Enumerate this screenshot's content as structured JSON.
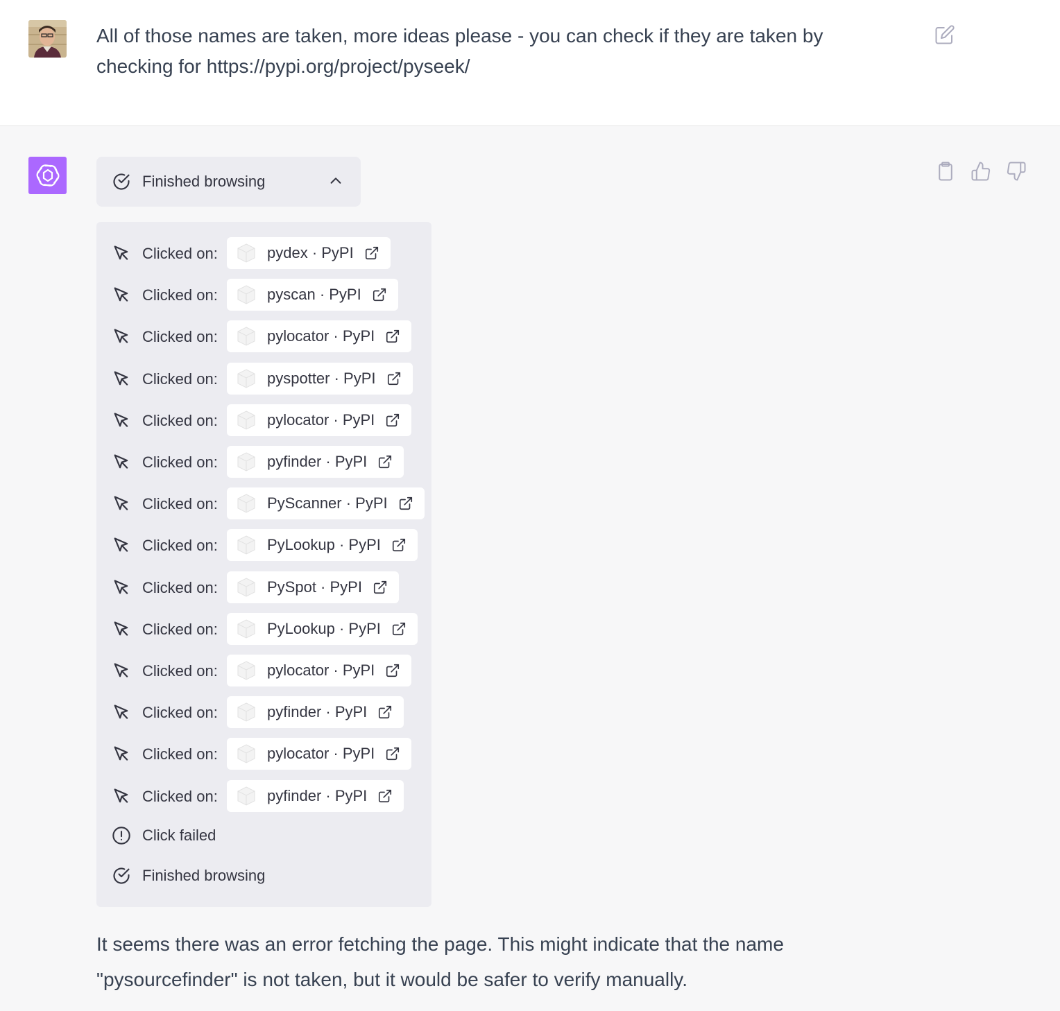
{
  "user_message": {
    "text": "All of those names are taken, more ideas please - you can check if they are taken by checking for https://pypi.org/project/pyseek/"
  },
  "assistant": {
    "browse_toggle_label": "Finished browsing",
    "log": [
      {
        "action": "Clicked on:",
        "link": "pydex · PyPI"
      },
      {
        "action": "Clicked on:",
        "link": "pyscan · PyPI"
      },
      {
        "action": "Clicked on:",
        "link": "pylocator · PyPI"
      },
      {
        "action": "Clicked on:",
        "link": "pyspotter · PyPI"
      },
      {
        "action": "Clicked on:",
        "link": "pylocator · PyPI"
      },
      {
        "action": "Clicked on:",
        "link": "pyfinder · PyPI"
      },
      {
        "action": "Clicked on:",
        "link": "PyScanner · PyPI"
      },
      {
        "action": "Clicked on:",
        "link": "PyLookup · PyPI"
      },
      {
        "action": "Clicked on:",
        "link": "PySpot · PyPI"
      },
      {
        "action": "Clicked on:",
        "link": "PyLookup · PyPI"
      },
      {
        "action": "Clicked on:",
        "link": "pylocator · PyPI"
      },
      {
        "action": "Clicked on:",
        "link": "pyfinder · PyPI"
      },
      {
        "action": "Clicked on:",
        "link": "pylocator · PyPI"
      },
      {
        "action": "Clicked on:",
        "link": "pyfinder · PyPI"
      }
    ],
    "click_failed_label": "Click failed",
    "finished_label": "Finished browsing",
    "reply_text": "It seems there was an error fetching the page. This might indicate that the name \"pysourcefinder\" is not taken, but it would be safer to verify manually."
  },
  "icons": {
    "edit": "edit-icon",
    "copy": "clipboard-icon",
    "thumbs_up": "thumbs-up-icon",
    "thumbs_down": "thumbs-down-icon"
  },
  "colors": {
    "brand": "#ab68ff",
    "assistant_bg": "#f7f7f8",
    "panel_bg": "#ececf1"
  }
}
